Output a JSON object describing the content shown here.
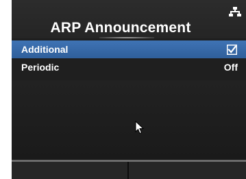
{
  "header": {
    "title": "ARP Announcement",
    "status_icon": "network-icon"
  },
  "menu": {
    "items": [
      {
        "label": "Additional",
        "value_type": "checkbox",
        "checked": true,
        "selected": true
      },
      {
        "label": "Periodic",
        "value": "Off",
        "selected": false
      }
    ]
  },
  "colors": {
    "screen_bg": "#1f1f1f",
    "selected_row": "#3a6cab",
    "text": "#ffffff",
    "outer_bg": "#ffffff"
  },
  "footer": {
    "softkeys": [
      "",
      ""
    ]
  }
}
